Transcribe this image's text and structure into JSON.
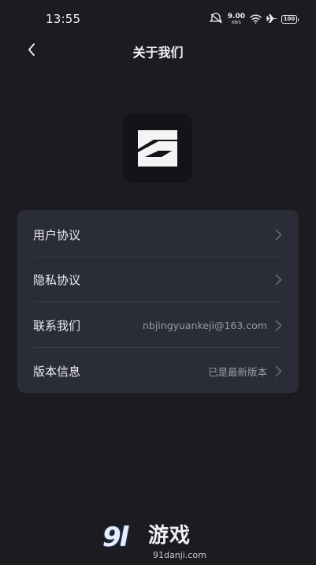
{
  "status_bar": {
    "time": "13:55",
    "net_speed_value": "9.00",
    "net_speed_unit": "KB/S",
    "battery": "100",
    "icons": [
      "mute-icon",
      "wifi-icon",
      "airplane-icon",
      "battery-icon"
    ]
  },
  "header": {
    "title": "关于我们",
    "back_icon": "chevron-left-icon"
  },
  "logo": {
    "name": "app-logo"
  },
  "menu": {
    "items": [
      {
        "label": "用户协议",
        "value": ""
      },
      {
        "label": "隐私协议",
        "value": ""
      },
      {
        "label": "联系我们",
        "value": "nbjingyuankeji@163.com"
      },
      {
        "label": "版本信息",
        "value": "已是最新版本"
      }
    ]
  },
  "watermark": {
    "number": "9l",
    "text": "游戏",
    "domain": "91danji.com"
  },
  "colors": {
    "background": "#1b1b20",
    "card": "#2a2c37",
    "secondary_text": "#9a9ba6"
  }
}
